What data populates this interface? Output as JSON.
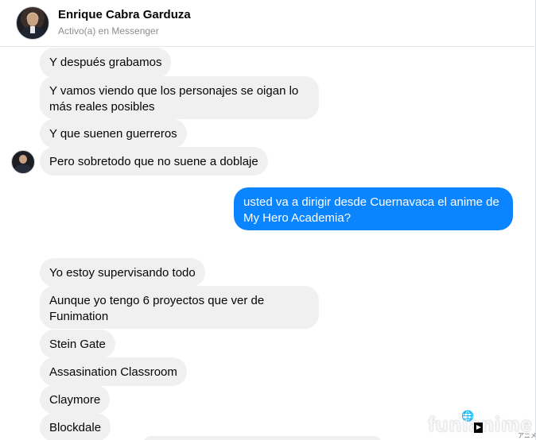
{
  "header": {
    "contact_name": "Enrique Cabra Garduza",
    "status": "Activo(a) en Messenger"
  },
  "messages": [
    {
      "direction": "incoming",
      "text": "Y después grabamos"
    },
    {
      "direction": "incoming",
      "text": "Y vamos viendo que los personajes se oigan lo más reales posibles"
    },
    {
      "direction": "incoming",
      "text": "Y que suenen guerreros"
    },
    {
      "direction": "incoming",
      "text": "Pero sobretodo que no suene a doblaje"
    },
    {
      "direction": "outgoing",
      "text": "usted va a dirigir desde Cuernavaca el anime de My Hero Academia?"
    },
    {
      "direction": "incoming",
      "text": "Yo estoy supervisando todo"
    },
    {
      "direction": "incoming",
      "text": "Aunque yo tengo 6 proyectos que ver de Funimation"
    },
    {
      "direction": "incoming",
      "text": "Stein Gate"
    },
    {
      "direction": "incoming",
      "text": "Assasination Classroom"
    },
    {
      "direction": "incoming",
      "text": "Claymore"
    },
    {
      "direction": "incoming",
      "text": "Blockdale"
    }
  ],
  "watermark": {
    "text": "funianime",
    "subtext": "アニメ"
  },
  "colors": {
    "outgoing_bubble": "#0a84ff",
    "incoming_bubble": "#f0f0f0",
    "status_text": "#8a8d91"
  },
  "icons": {
    "watermark_globe": "globe-icon",
    "watermark_play": "play-icon"
  }
}
